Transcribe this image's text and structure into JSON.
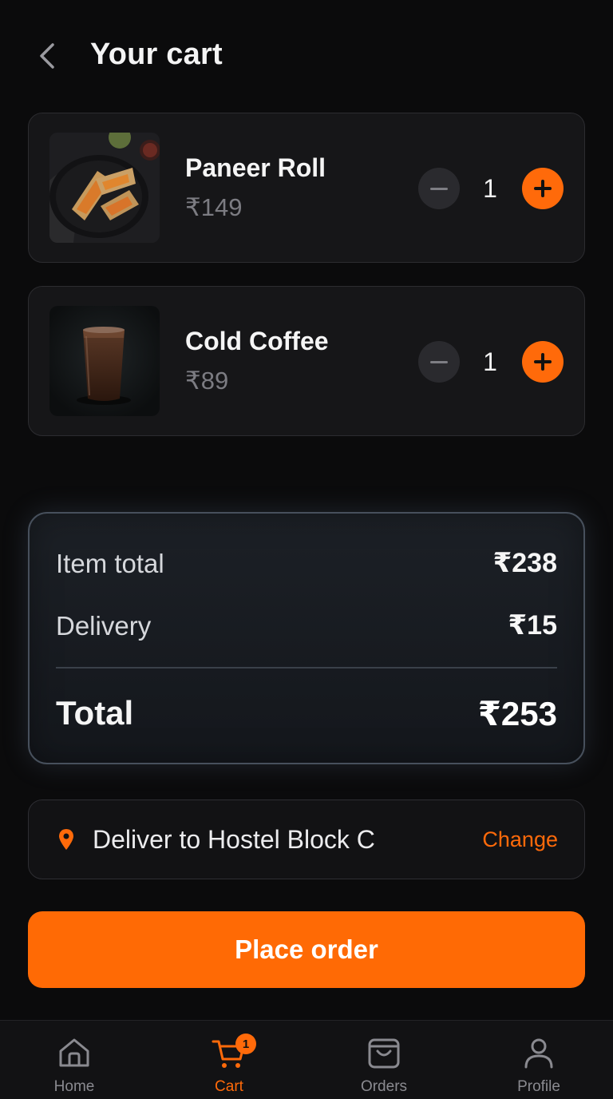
{
  "header": {
    "title": "Your cart"
  },
  "items": [
    {
      "name": "Paneer Roll",
      "price": "₹149",
      "qty": "1"
    },
    {
      "name": "Cold Coffee",
      "price": "₹89",
      "qty": "1"
    }
  ],
  "summary": {
    "item_total_label": "Item total",
    "item_total_value": "₹238",
    "delivery_label": "Delivery",
    "delivery_value": "₹15",
    "total_label": "Total",
    "total_value": "₹253"
  },
  "address": {
    "text": "Deliver to Hostel Block C",
    "change_label": "Change"
  },
  "place_order": {
    "label": "Place order"
  },
  "nav": {
    "items": [
      {
        "label": "Home",
        "icon": "home-icon"
      },
      {
        "label": "Cart",
        "icon": "cart-icon",
        "badge": "1"
      },
      {
        "label": "Orders",
        "icon": "orders-bag-icon"
      },
      {
        "label": "Profile",
        "icon": "profile-icon"
      }
    ]
  },
  "colors": {
    "accent": "#ff6a0a",
    "background": "#0b0b0c",
    "card": "#161618"
  }
}
